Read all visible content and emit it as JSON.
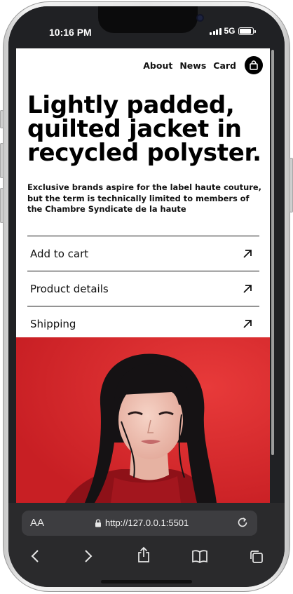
{
  "status_bar": {
    "time": "10:16 PM",
    "network": "5G",
    "battery_level": 0.9
  },
  "page": {
    "nav": {
      "links": [
        "About",
        "News",
        "Card"
      ],
      "cart_icon": "shopping-bag-icon"
    },
    "headline": "Lightly padded, quilted jacket in recycled polyster.",
    "lede": "Exclusive brands aspire for the label haute couture, but the term is technically limited to members of the Chambre Syndicate de la haute",
    "accordion": [
      {
        "label": "Add to cart",
        "icon": "arrow-up-right-icon"
      },
      {
        "label": "Product details",
        "icon": "arrow-up-right-icon"
      },
      {
        "label": "Shipping",
        "icon": "arrow-up-right-icon"
      }
    ],
    "hero_image": {
      "description": "woman-with-black-bangs-red-sweater-on-red-background",
      "background": "#d8272b"
    }
  },
  "browser": {
    "text_size_label": "AA",
    "url": "http://127.0.0.1:5501",
    "toolbar": [
      "back-icon",
      "forward-icon",
      "share-icon",
      "bookmarks-icon",
      "tabs-icon"
    ]
  },
  "colors": {
    "frame": "#202124",
    "chrome": "#2a2a2c",
    "url_bar": "#3d3d40",
    "accent": "#d8272b"
  }
}
